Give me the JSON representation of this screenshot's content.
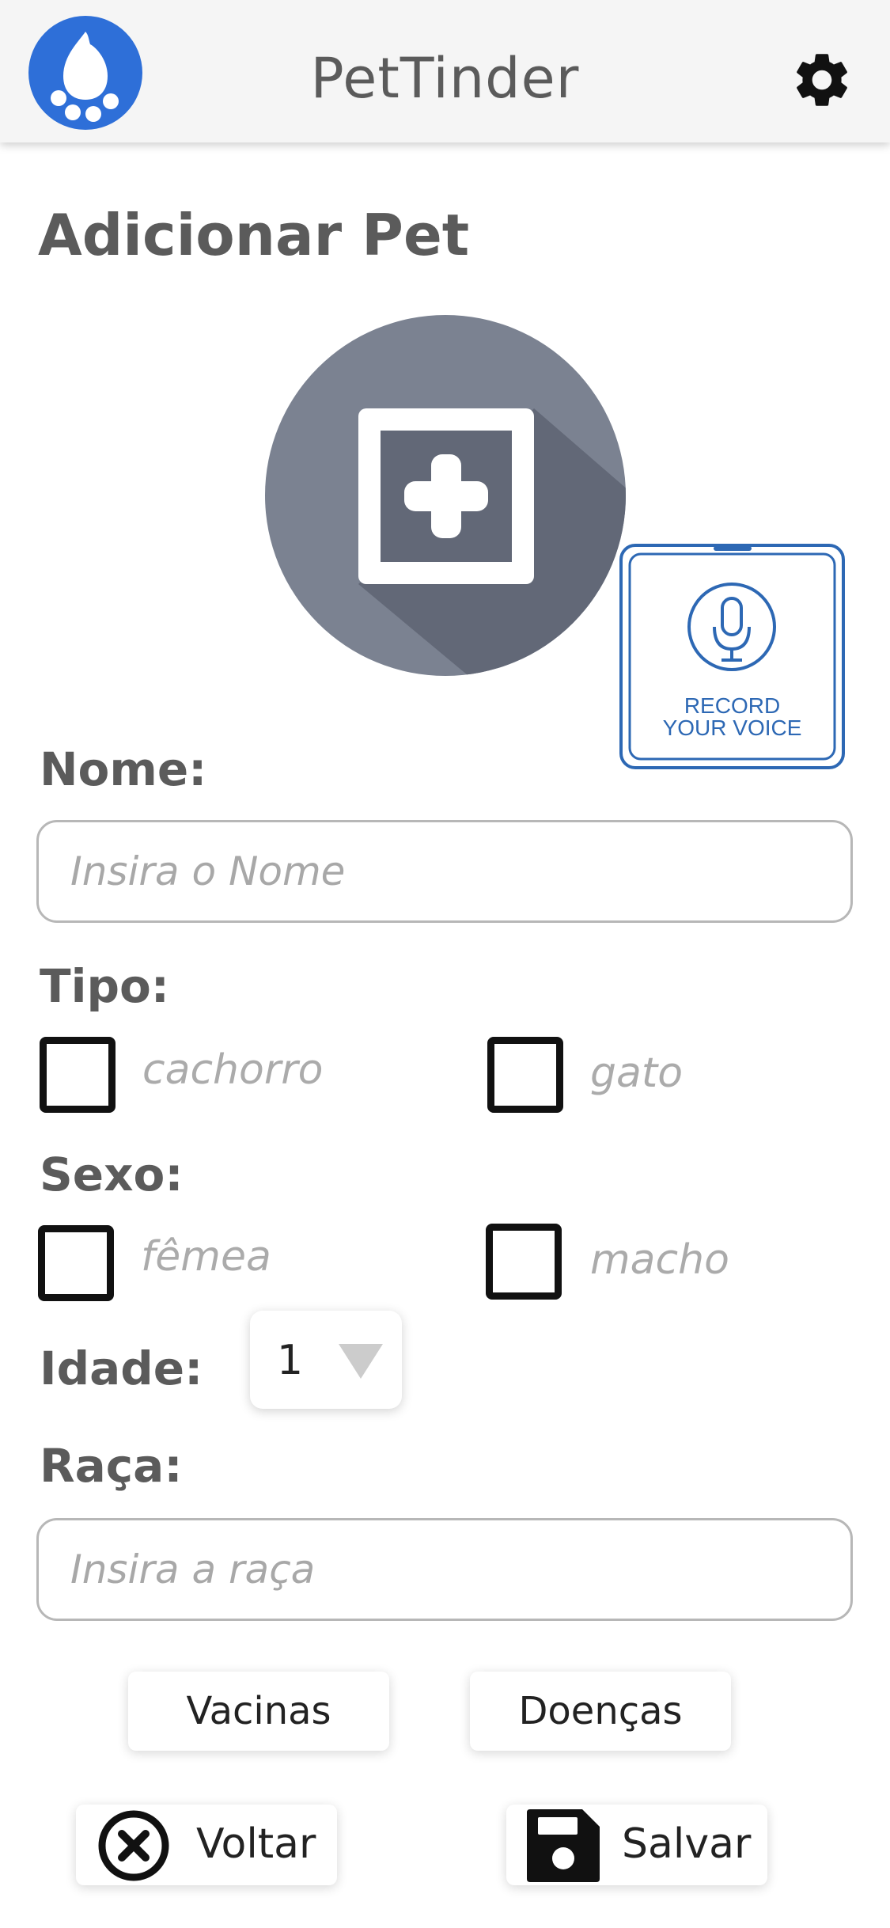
{
  "header": {
    "title": "PetTinder",
    "logo_icon": "paw-logo-icon",
    "settings_icon": "gear-icon"
  },
  "page": {
    "title": "Adicionar Pet",
    "photo_icon": "add-photo-icon",
    "voice_lines": [
      "RECORD",
      "YOUR VOICE"
    ]
  },
  "form": {
    "name": {
      "label": "Nome:",
      "placeholder": "Insira o Nome",
      "value": ""
    },
    "type": {
      "label": "Tipo:",
      "options": [
        "cachorro",
        "gato"
      ],
      "checked": [
        false,
        false
      ]
    },
    "sex": {
      "label": "Sexo:",
      "options": [
        "fêmea",
        "macho"
      ],
      "checked": [
        false,
        false
      ]
    },
    "age": {
      "label": "Idade:",
      "value": "1"
    },
    "breed": {
      "label": "Raça:",
      "placeholder": "Insira a raça",
      "value": ""
    }
  },
  "buttons": {
    "vaccines": "Vacinas",
    "diseases": "Doenças",
    "back": "Voltar",
    "save": "Salvar"
  },
  "colors": {
    "logo_blue": "#2e6fd8",
    "photo_gray": "#7b8291",
    "voice_blue": "#2d68b4"
  }
}
